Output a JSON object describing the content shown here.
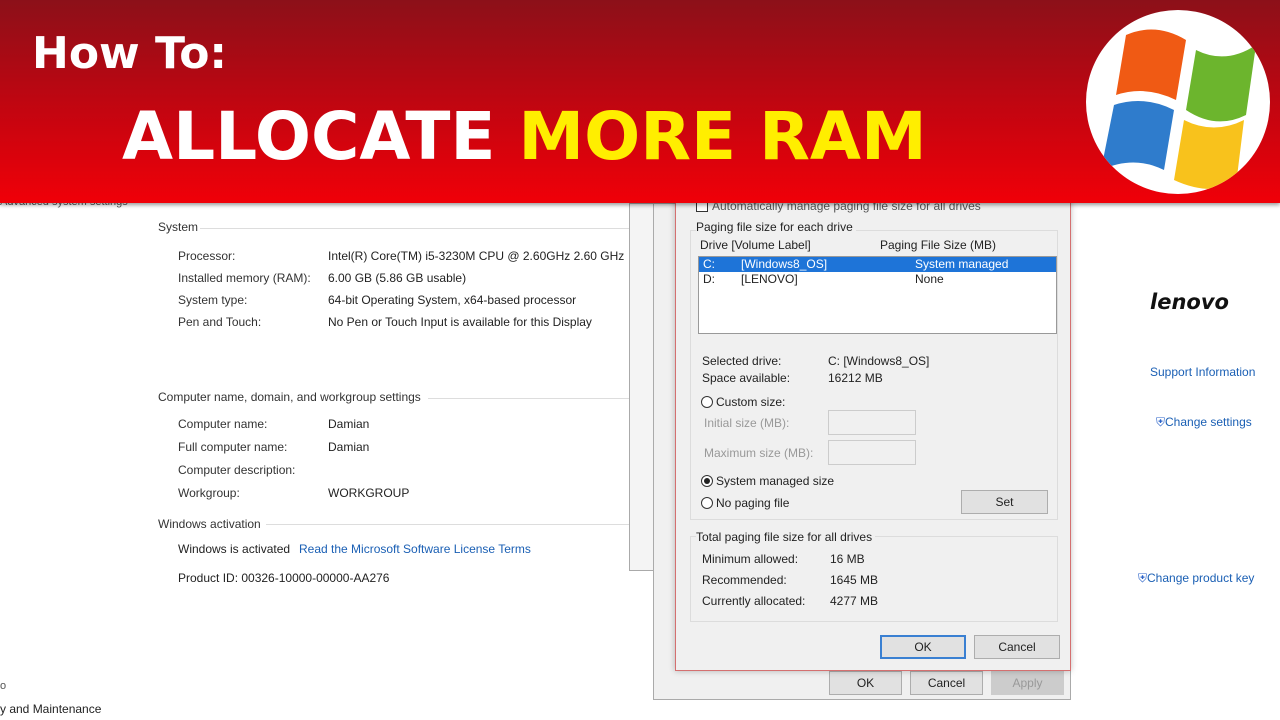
{
  "banner": {
    "how_to": "How To:",
    "title_white": "ALLOCATE ",
    "title_yellow": "MORE RAM",
    "logo": "windows-logo"
  },
  "left_panel": {
    "advanced_link": "Advanced system settings",
    "bottom_link_1": "o",
    "bottom_link_2": "y and Maintenance"
  },
  "system": {
    "heading": "System",
    "rows": [
      {
        "label": "Processor:",
        "value": "Intel(R) Core(TM) i5-3230M CPU @ 2.60GHz   2.60 GHz"
      },
      {
        "label": "Installed memory (RAM):",
        "value": "6.00 GB (5.86 GB usable)"
      },
      {
        "label": "System type:",
        "value": "64-bit Operating System, x64-based processor"
      },
      {
        "label": "Pen and Touch:",
        "value": "No Pen or Touch Input is available for this Display"
      }
    ]
  },
  "computer": {
    "heading": "Computer name, domain, and workgroup settings",
    "rows": [
      {
        "label": "Computer name:",
        "value": "Damian"
      },
      {
        "label": "Full computer name:",
        "value": "Damian"
      },
      {
        "label": "Computer description:",
        "value": ""
      },
      {
        "label": "Workgroup:",
        "value": "WORKGROUP"
      }
    ]
  },
  "activation": {
    "heading": "Windows activation",
    "status": "Windows is activated",
    "license_link": "Read the Microsoft Software License Terms",
    "product_id": "Product ID: 00326-10000-00000-AA276"
  },
  "right": {
    "brand": "lenovo",
    "support": "Support Information",
    "change_settings": "Change settings",
    "change_key": "Change product key"
  },
  "perf_dialog": {
    "ok": "OK",
    "cancel": "Cancel",
    "apply": "Apply"
  },
  "vm_dialog": {
    "auto_manage": "Automatically manage paging file size for all drives",
    "group_title": "Paging file size for each drive",
    "col_drive": "Drive  [Volume Label]",
    "col_size": "Paging File Size (MB)",
    "drives": [
      {
        "drive": "C:",
        "label": "[Windows8_OS]",
        "size": "System managed",
        "selected": true
      },
      {
        "drive": "D:",
        "label": "[LENOVO]",
        "size": "None",
        "selected": false
      }
    ],
    "selected_drive_label": "Selected drive:",
    "selected_drive": "C:  [Windows8_OS]",
    "space_label": "Space available:",
    "space": "16212 MB",
    "custom": "Custom size:",
    "initial": "Initial size (MB):",
    "maximum": "Maximum size (MB):",
    "system_managed": "System managed size",
    "no_paging": "No paging file",
    "set": "Set",
    "total_title": "Total paging file size for all drives",
    "min_label": "Minimum allowed:",
    "min": "16 MB",
    "rec_label": "Recommended:",
    "rec": "1645 MB",
    "cur_label": "Currently allocated:",
    "cur": "4277 MB",
    "ok": "OK",
    "cancel": "Cancel"
  }
}
